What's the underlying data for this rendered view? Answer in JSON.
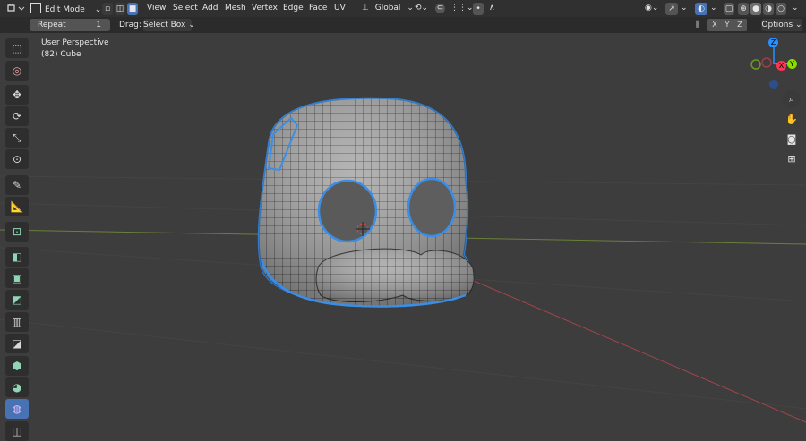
{
  "header": {
    "mode_label": "Edit Mode",
    "menus": [
      "View",
      "Select",
      "Add",
      "Mesh",
      "Vertex",
      "Edge",
      "Face",
      "UV"
    ],
    "transform_orientation": "Global"
  },
  "subheader": {
    "repeat_label": "Repeat",
    "repeat_value": "1",
    "drag_label": "Drag:",
    "drag_value": "Select Box",
    "axis_x": "X",
    "axis_y": "Y",
    "axis_z": "Z",
    "options_label": "Options"
  },
  "viewport": {
    "perspective_label": "User Perspective",
    "object_label": "(82) Cube"
  },
  "gizmo": {
    "z_label": "Z",
    "y_label": "Y",
    "x_label": "X",
    "colors": {
      "x": "#ff3352",
      "y": "#8bdc00",
      "z": "#2890ff"
    }
  },
  "icons": {
    "toolbar": [
      "select-box-icon",
      "cursor-icon",
      "move-icon",
      "rotate-icon",
      "scale-icon",
      "transform-icon",
      "annotate-icon",
      "measure-icon",
      "add-cube-icon",
      "extrude-icon",
      "inset-icon",
      "bevel-icon",
      "loop-cut-icon",
      "knife-icon",
      "poly-build-icon",
      "spin-icon",
      "smooth-icon",
      "shrink-icon"
    ],
    "nav": [
      "zoom-icon",
      "hand-icon",
      "camera-icon",
      "grid-icon"
    ]
  },
  "colors": {
    "accent": "#4772b3",
    "selection": "#3a8ee6"
  }
}
